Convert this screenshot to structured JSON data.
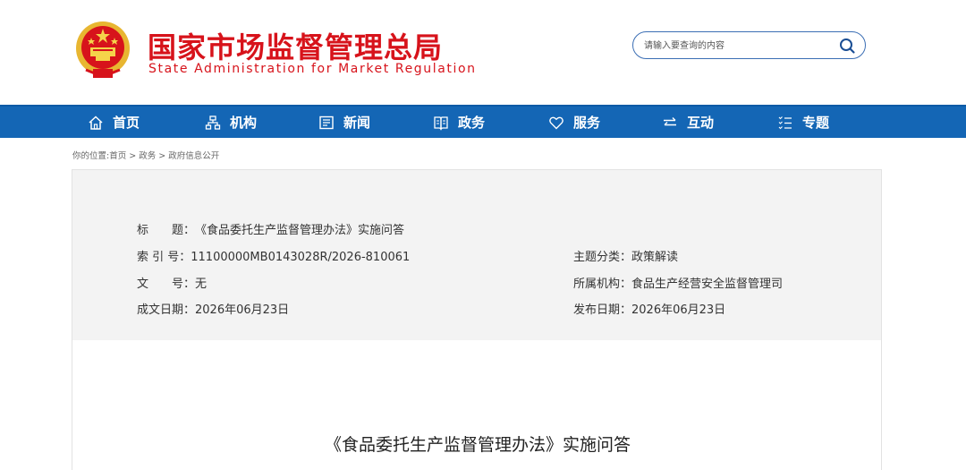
{
  "header": {
    "site_name_cn": "国家市场监督管理总局",
    "site_name_en": "State Administration for Market Regulation",
    "emblem_icon": "national-emblem-icon",
    "brand_color": "#d7131b"
  },
  "search": {
    "placeholder": "请输入要查询的内容",
    "icon": "search-icon"
  },
  "nav": {
    "color": "#1466b5",
    "items": [
      {
        "label": "首页",
        "icon": "home-icon"
      },
      {
        "label": "机构",
        "icon": "org-chart-icon"
      },
      {
        "label": "新闻",
        "icon": "news-icon"
      },
      {
        "label": "政务",
        "icon": "affairs-icon"
      },
      {
        "label": "服务",
        "icon": "heart-icon"
      },
      {
        "label": "互动",
        "icon": "exchange-arrows-icon"
      },
      {
        "label": "专题",
        "icon": "list-icon"
      }
    ]
  },
  "breadcrumb": {
    "prefix": "你的位置:",
    "items": [
      "首页",
      "政务",
      "政府信息公开"
    ],
    "separator": " > "
  },
  "info": {
    "title_label": "标　　题：",
    "title_value": "《食品委托生产监督管理办法》实施问答",
    "index_label": "索 引 号：",
    "index_value": "11100000MB0143028R/2026-810061",
    "topic_label": "主题分类：",
    "topic_value": "政策解读",
    "docno_label": "文　　号：",
    "docno_value": "无",
    "org_label": "所属机构：",
    "org_value": "食品生产经营安全监督管理司",
    "written_label": "成文日期：",
    "written_value": "2026年06月23日",
    "published_label": "发布日期：",
    "published_value": "2026年06月23日"
  },
  "content": {
    "title": "《食品委托生产监督管理办法》实施问答"
  }
}
